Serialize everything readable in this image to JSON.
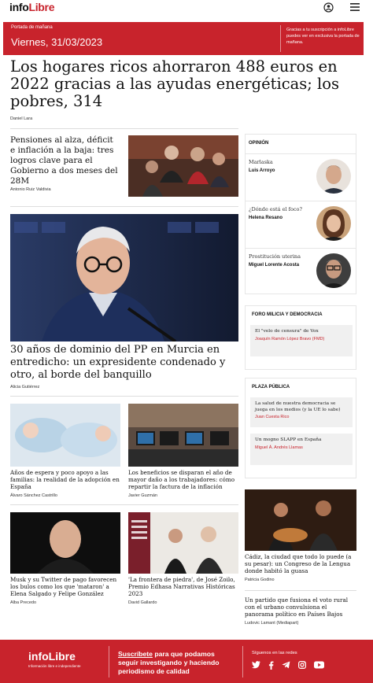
{
  "header": {
    "logo_info": "info",
    "logo_libre": "Libre",
    "account_icon": "account-circle-icon",
    "menu_icon": "hamburger-menu-icon"
  },
  "banner": {
    "label": "Portada de mañana",
    "date": "Viernes, 31/03/2023",
    "message": "Gracias a tu suscripción a infoLibre puedes ver en exclusiva la portada de mañana."
  },
  "lead": {
    "title": "Los hogares ricos ahorraron 488 euros en 2022 gracias a las ayudas energéticas; los pobres, 314",
    "author": "Daniel Lara"
  },
  "stories": [
    {
      "title": "Pensiones al alza, déficit e inflación a la baja: tres logros clave para el Gobierno a dos meses del 28M",
      "author": "Antonio Ruiz Valdivia"
    },
    {
      "title": "30 años de dominio del PP en Murcia en entredicho: un expresidente condenado y otro, al borde del banquillo",
      "author": "Alicia Gutiérrez"
    },
    {
      "title": "Años de espera y poco apoyo a las familias: la realidad de la adopción en España",
      "author": "Álvaro Sánchez Castrillo"
    },
    {
      "title": "Los beneficios se disparan el año de mayor daño a los trabajadores: cómo repartir la factura de la inflación",
      "author": "Javier Guzmán"
    },
    {
      "title": "Musk y su Twitter de pago favorecen los bulos como los que 'mataron' a Elena Salgado y Felipe González",
      "author": "Alba Precedo"
    },
    {
      "title": "'La frontera de piedra', de José Zoilo, Premio Edhasa Narrativas Históricas 2023",
      "author": "David Gallardo"
    },
    {
      "title": "Cádiz, la ciudad que todo lo puede (a su pesar): un Congreso de la Lengua donde habitó la guasa",
      "author": "Patricia Godino"
    },
    {
      "title": "Un partido que fusiona el voto rural con el urbano convulsiona el panorama político en Países Bajos",
      "author": "Ludovic Lamant (Mediapart)"
    }
  ],
  "opinion": {
    "heading": "OPINIÓN",
    "items": [
      {
        "topic": "Marlaska",
        "author": "Luis Arroyo"
      },
      {
        "topic": "¿Dónde está el foco?",
        "author": "Helena Resano"
      },
      {
        "topic": "Prostitución uterina",
        "author": "Miguel Lorente Acosta"
      }
    ]
  },
  "foro": {
    "heading": "FORO MILICIA Y DEMOCRACIA",
    "items": [
      {
        "title": "El \"velo de censura\" de Vox",
        "author": "Joaquín Ramón López Bravo (FMD)"
      }
    ]
  },
  "plaza": {
    "heading": "PLAZA PÚBLICA",
    "items": [
      {
        "title": "La salud de nuestra democracia se juega en los medios (y la UE lo sabe)",
        "author": "Juan Cuesta Rico"
      },
      {
        "title": "Un mogno SLAPP en España",
        "author": "Miguel Á. Andrés Llamas"
      }
    ]
  },
  "footer": {
    "logo": "infoLibre",
    "tagline": "Información libre e independiente",
    "cta_link": "Suscríbete",
    "cta_rest": " para que podamos seguir investigando y haciendo periodismo de calidad",
    "social_label": "Síguenos en las redes",
    "social_icons": [
      "twitter-icon",
      "facebook-icon",
      "telegram-icon",
      "instagram-icon",
      "youtube-icon"
    ]
  },
  "colors": {
    "brand_red": "#c8232c"
  }
}
